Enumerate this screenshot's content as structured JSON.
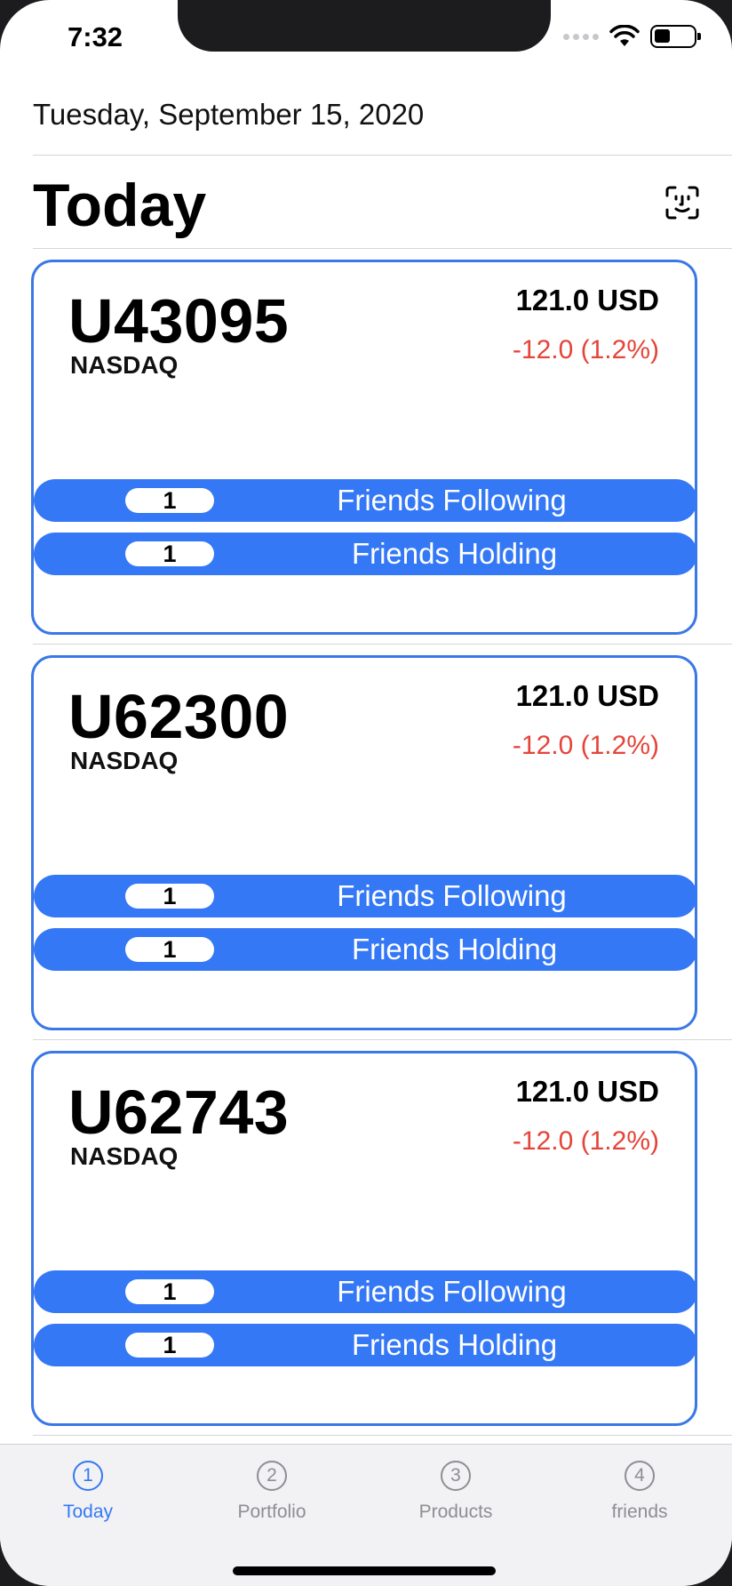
{
  "status_bar": {
    "time": "7:32"
  },
  "header": {
    "date": "Tuesday, September 15, 2020",
    "title": "Today"
  },
  "stocks": [
    {
      "symbol": "U43095",
      "exchange": "NASDAQ",
      "price": "121.0 USD",
      "change": "-12.0 (1.2%)",
      "following_count": "1",
      "following_label": "Friends Following",
      "holding_count": "1",
      "holding_label": "Friends Holding"
    },
    {
      "symbol": "U62300",
      "exchange": "NASDAQ",
      "price": "121.0 USD",
      "change": "-12.0 (1.2%)",
      "following_count": "1",
      "following_label": "Friends Following",
      "holding_count": "1",
      "holding_label": "Friends Holding"
    },
    {
      "symbol": "U62743",
      "exchange": "NASDAQ",
      "price": "121.0 USD",
      "change": "-12.0 (1.2%)",
      "following_count": "1",
      "following_label": "Friends Following",
      "holding_count": "1",
      "holding_label": "Friends Holding"
    }
  ],
  "tabs": [
    {
      "number": "1",
      "label": "Today",
      "active": true
    },
    {
      "number": "2",
      "label": "Portfolio",
      "active": false
    },
    {
      "number": "3",
      "label": "Products",
      "active": false
    },
    {
      "number": "4",
      "label": "friends",
      "active": false
    }
  ],
  "colors": {
    "accent": "#3478f6",
    "negative": "#e5443a",
    "card_border": "#3a78e6"
  },
  "icons": {
    "header_action": "face-scan-icon"
  }
}
